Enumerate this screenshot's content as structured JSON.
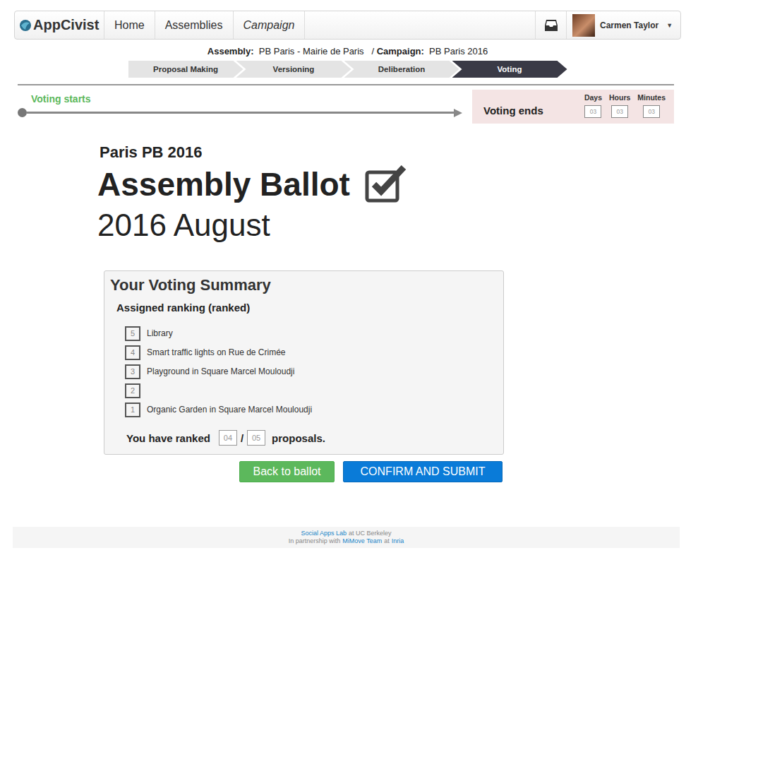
{
  "nav": {
    "logo": "AppCivist",
    "items": [
      {
        "label": "Home",
        "selected": false
      },
      {
        "label": "Assemblies",
        "selected": false
      },
      {
        "label": "Campaign",
        "selected": true
      }
    ],
    "user": "Carmen Taylor",
    "caret": "▼"
  },
  "context": {
    "assembly_label": "Assembly:",
    "assembly": "PB Paris - Mairie de Paris",
    "separator": "/",
    "campaign_label": "Campaign:",
    "campaign": "PB Paris 2016"
  },
  "phases": [
    {
      "label": "Proposal Making",
      "selected": false
    },
    {
      "label": "Versioning",
      "selected": false
    },
    {
      "label": "Deliberation",
      "selected": false
    },
    {
      "label": "Voting",
      "selected": true
    }
  ],
  "timeline": {
    "start_label": "Voting starts",
    "end_label": "Voting ends",
    "countdown": [
      {
        "label": "Days",
        "value": "03"
      },
      {
        "label": "Hours",
        "value": "03"
      },
      {
        "label": "Minutes",
        "value": "03"
      }
    ]
  },
  "ballot": {
    "campaign": "Paris PB 2016",
    "title": "Assembly Ballot",
    "date": "2016 August"
  },
  "summary": {
    "title": "Your Voting Summary",
    "subtitle": "Assigned ranking (ranked)",
    "rankings": [
      {
        "rank": "5",
        "proposal": "Library"
      },
      {
        "rank": "4",
        "proposal": "Smart traffic lights on Rue de Crimée"
      },
      {
        "rank": "3",
        "proposal": "Playground in Square Marcel Mouloudji"
      },
      {
        "rank": "2",
        "proposal": ""
      },
      {
        "rank": "1",
        "proposal": "Organic Garden in Square Marcel Mouloudji"
      }
    ],
    "count_prefix": "You have ranked",
    "ranked": "04",
    "separator": "/",
    "total": "05",
    "count_suffix": "proposals."
  },
  "buttons": [
    {
      "label": "Back to ballot",
      "kind": "secondary"
    },
    {
      "label": "CONFIRM AND SUBMIT",
      "kind": "primary"
    }
  ],
  "footer": {
    "lines": [
      [
        {
          "text": "Social Apps Lab",
          "link": true
        },
        {
          "text": "at UC Berkeley",
          "link": false
        }
      ],
      [
        {
          "text": "In partnership with",
          "link": false
        },
        {
          "text": "MiMove Team",
          "link": true
        },
        {
          "text": "at",
          "link": false
        },
        {
          "text": "Inria",
          "link": true
        }
      ]
    ]
  }
}
